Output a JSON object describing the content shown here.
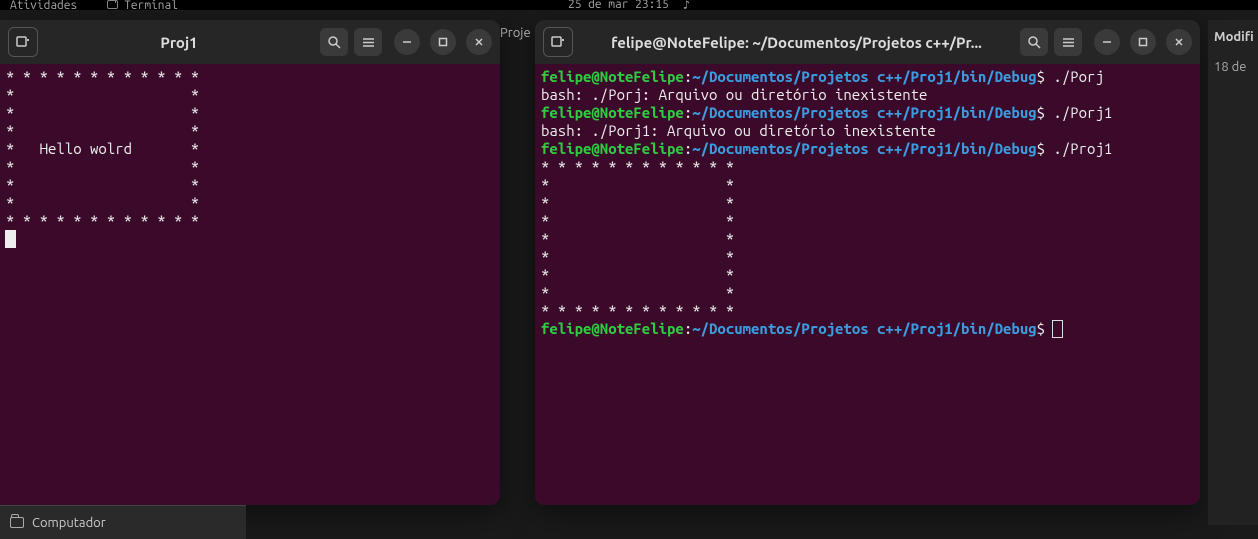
{
  "topbar": {
    "activities": "Atividades",
    "terminal": "Terminal",
    "datetime": "25 de mar  23:15"
  },
  "bg_tab": "Proje",
  "window_left": {
    "title": "Proj1",
    "output": [
      "* * * * * * * * * * * *",
      "*                     *",
      "*                     *",
      "*                     *",
      "*   Hello wolrd       *",
      "*                     *",
      "*                     *",
      "*                     *",
      "* * * * * * * * * * * *"
    ]
  },
  "window_right": {
    "title": "felipe@NoteFelipe: ~/Documentos/Projetos c++/Pr...",
    "prompt_user": "felipe@NoteFelipe",
    "prompt_sep": ":",
    "prompt_path": "~/Documentos/Projetos c++/Proj1/bin/Debug",
    "prompt_end": "$",
    "lines": {
      "cmd1": " ./Porj",
      "err1": "bash: ./Porj: Arquivo ou diretório inexistente",
      "cmd2": " ./Porj1",
      "err2": "bash: ./Porj1: Arquivo ou diretório inexistente",
      "cmd3": " ./Proj1",
      "box": [
        "* * * * * * * * * * * *",
        "*                     *",
        "*                     *",
        "*                     *",
        "*                     *",
        "*                     *",
        "*                     *",
        "*                     *",
        "* * * * * * * * * * * *"
      ]
    }
  },
  "bottom": {
    "label": "Computador"
  },
  "side": {
    "hdr": "Modifi",
    "row1": "18 de"
  }
}
